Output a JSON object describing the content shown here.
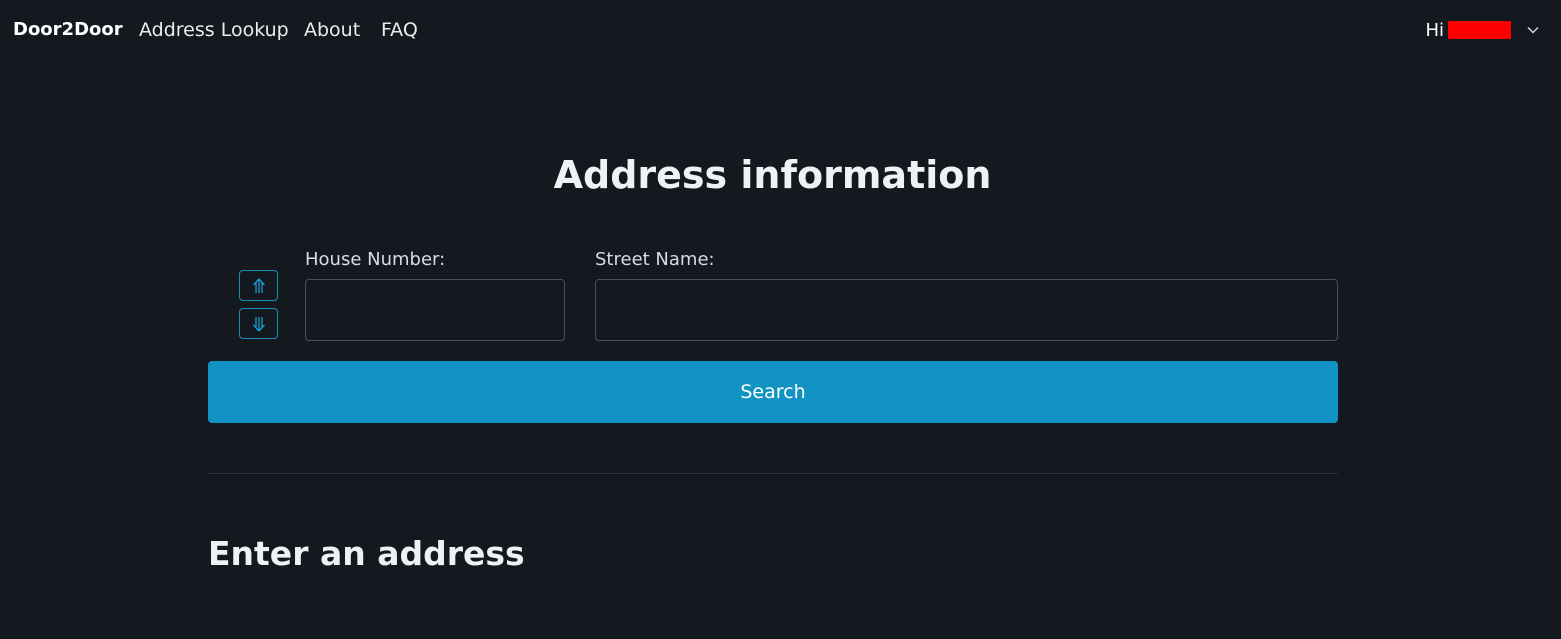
{
  "navbar": {
    "brand": "Door2Door",
    "links": [
      "Address Lookup",
      "About",
      "FAQ"
    ],
    "user_greeting": "Hi"
  },
  "page": {
    "title": "Address information"
  },
  "form": {
    "house_number_label": "House Number:",
    "house_number_value": "",
    "street_name_label": "Street Name:",
    "street_name_value": "",
    "search_label": "Search"
  },
  "results": {
    "heading": "Enter an address"
  },
  "icons": {
    "move_up": "arrow-up-icon",
    "move_down": "arrow-down-icon",
    "dropdown": "chevron-down-icon"
  },
  "colors": {
    "background": "#141920",
    "accent": "#1093c3",
    "redaction": "#ff0000"
  }
}
